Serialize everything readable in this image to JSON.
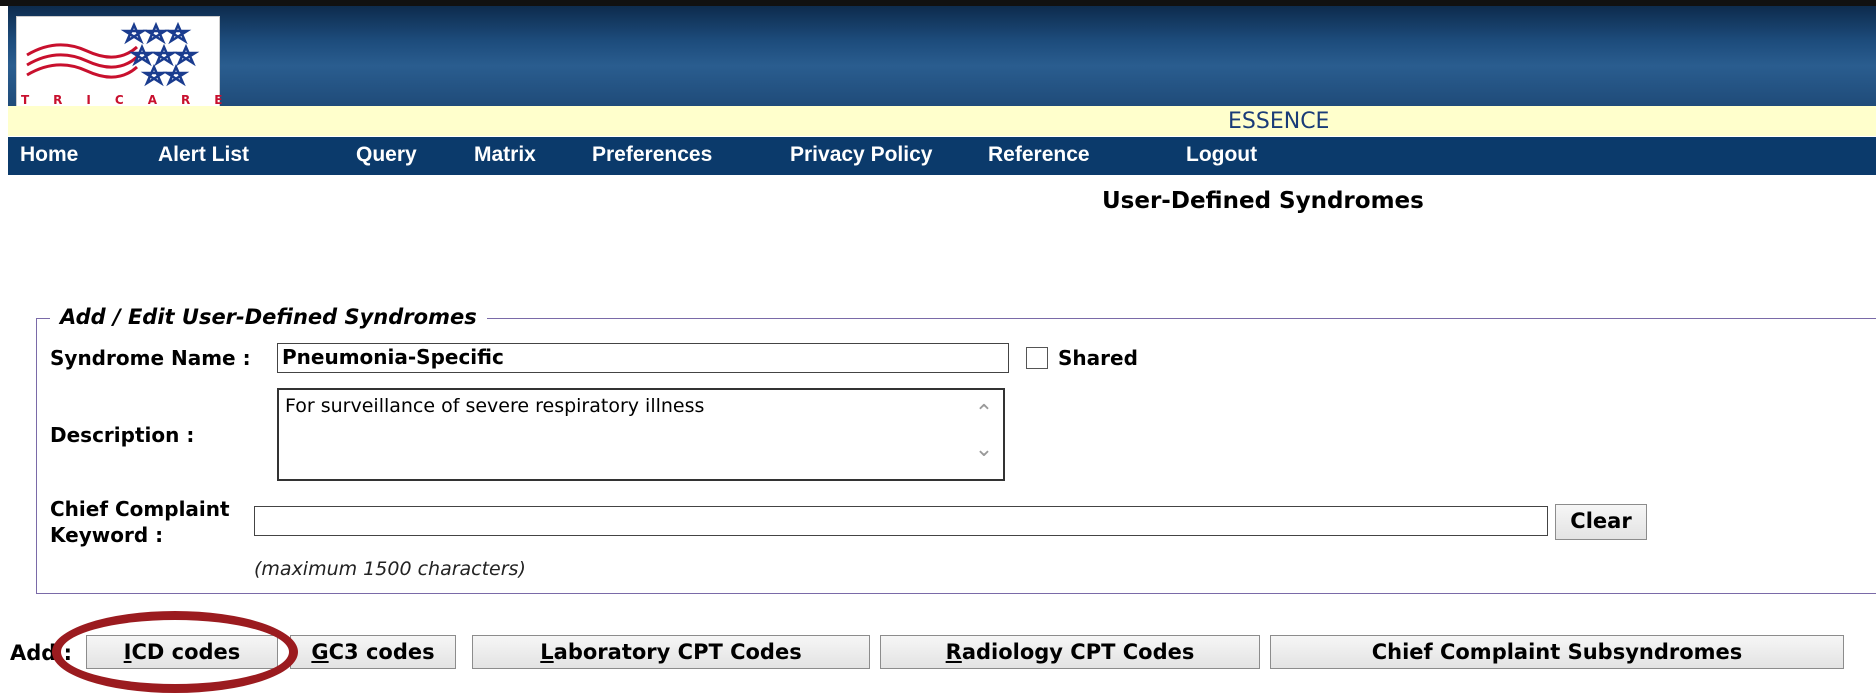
{
  "app": {
    "logo_text": "TRICARE",
    "title": "ESSENCE"
  },
  "nav": {
    "items": [
      {
        "label": "Home"
      },
      {
        "label": "Alert List"
      },
      {
        "label": "Query"
      },
      {
        "label": "Matrix"
      },
      {
        "label": "Preferences"
      },
      {
        "label": "Privacy Policy"
      },
      {
        "label": "Reference"
      },
      {
        "label": "Logout"
      }
    ]
  },
  "page": {
    "heading": "User-Defined Syndromes"
  },
  "form": {
    "legend": "Add / Edit User-Defined Syndromes",
    "syndrome_name_label": "Syndrome Name :",
    "syndrome_name_value": "Pneumonia-Specific",
    "shared_label": "Shared",
    "shared_checked": false,
    "description_label": "Description :",
    "description_value": "For surveillance of severe respiratory illness",
    "chief_complaint_label_1": "Chief Complaint",
    "chief_complaint_label_2": "Keyword :",
    "chief_complaint_value": "",
    "clear_label": "Clear",
    "hint": "(maximum 1500 characters)"
  },
  "add_bar": {
    "label": "Add :",
    "buttons": [
      {
        "key": "I",
        "rest": "CD codes"
      },
      {
        "key": "G",
        "rest": "C3 codes"
      },
      {
        "key": "L",
        "rest": "aboratory CPT Codes"
      },
      {
        "key": "R",
        "rest": "adiology CPT Codes"
      },
      {
        "key": "",
        "rest": "Chief Complaint Subsyndromes"
      }
    ]
  },
  "colors": {
    "highlight": "#9b1b1f",
    "nav_bg": "#0b3a6b",
    "app_band_bg": "#ffffcc"
  }
}
